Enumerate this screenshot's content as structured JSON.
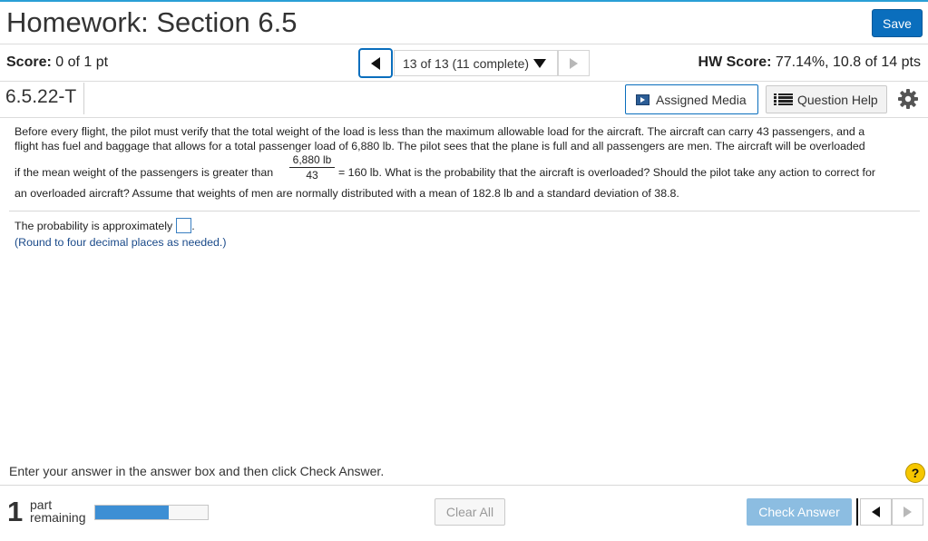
{
  "header": {
    "title": "Homework: Section 6.5",
    "save_label": "Save"
  },
  "scorebar": {
    "score_label": "Score:",
    "score_value": "0 of 1 pt",
    "nav_position": "13 of 13 (11 complete)",
    "hw_score_label": "HW Score:",
    "hw_score_value": "77.14%, 10.8 of 14 pts"
  },
  "question_header": {
    "id": "6.5.22-T",
    "assigned_media_label": "Assigned Media",
    "question_help_label": "Question Help"
  },
  "question": {
    "line1": "Before every flight, the pilot must verify that the total weight of the load is less than the maximum allowable load for the aircraft. The aircraft can carry 43 passengers, and a",
    "line2": "flight has fuel and baggage that allows for a total passenger load of 6,880 lb. The pilot sees that the plane is full and all passengers are men. The aircraft will be overloaded",
    "line3_before": "if the mean weight of the passengers is greater than",
    "fraction_numerator": "6,880 lb",
    "fraction_denominator": "43",
    "line3_after": "= 160 lb. What is the probability that the aircraft is overloaded? Should the pilot take any action to correct for",
    "line4": "an overloaded aircraft? Assume that weights of men are normally distributed with a mean of 182.8 lb and a standard deviation of 38.8."
  },
  "answer": {
    "prompt": "The probability is approximately",
    "suffix": ".",
    "value": "",
    "hint": "(Round to four decimal places as needed.)"
  },
  "footer": {
    "instruction": "Enter your answer in the answer box and then click Check Answer.",
    "help_symbol": "?",
    "parts_count": "1",
    "parts_word1": "part",
    "parts_word2": "remaining",
    "progress_fraction": 0.65,
    "clear_all_label": "Clear All",
    "check_answer_label": "Check Answer"
  },
  "colors": {
    "accent": "#0a6ebd",
    "top_line": "#2a9fd6",
    "progress_fill": "#3d8fd4",
    "check_answer_disabled": "#8cbde1",
    "help_icon": "#f6c700",
    "hint_text": "#1a4a8a"
  },
  "icons": {
    "nav_prev": "triangle-left-icon",
    "nav_dropdown": "triangle-down-icon",
    "nav_next": "triangle-right-icon",
    "assigned_media": "video-icon",
    "question_help": "list-icon",
    "settings": "gear-icon",
    "help": "question-mark-icon"
  }
}
